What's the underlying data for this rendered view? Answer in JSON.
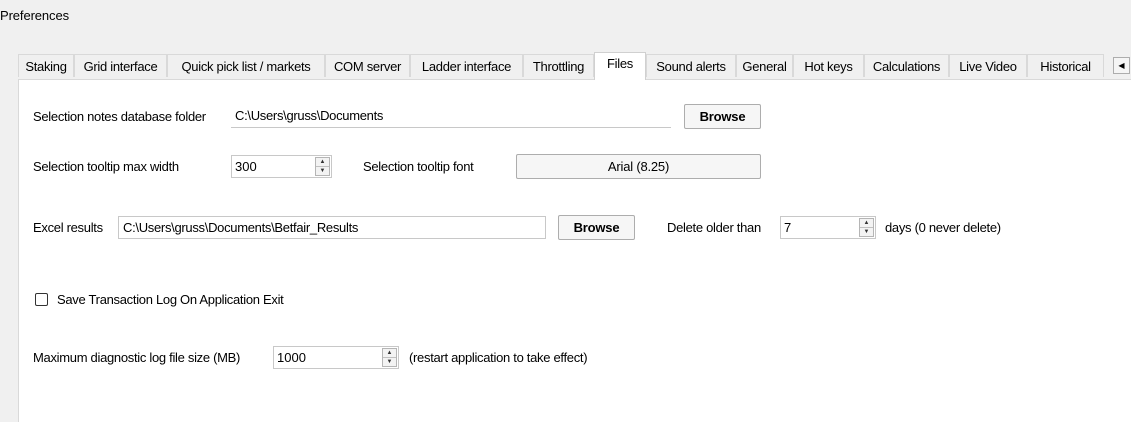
{
  "window": {
    "title": "Preferences"
  },
  "tabs": [
    {
      "label": "Staking"
    },
    {
      "label": "Grid interface"
    },
    {
      "label": "Quick pick list / markets"
    },
    {
      "label": "COM server"
    },
    {
      "label": "Ladder interface"
    },
    {
      "label": "Throttling"
    },
    {
      "label": "Files",
      "active": true
    },
    {
      "label": "Sound alerts"
    },
    {
      "label": "General"
    },
    {
      "label": "Hot keys"
    },
    {
      "label": "Calculations"
    },
    {
      "label": "Live Video"
    },
    {
      "label": "Historical"
    }
  ],
  "tab_scroll": {
    "left_icon": "triangle-left-icon",
    "right_icon": "triangle-right-icon"
  },
  "files": {
    "notes_folder_label": "Selection notes database folder",
    "notes_folder_value": "C:\\Users\\gruss\\Documents",
    "notes_browse_label": "Browse",
    "tooltip_width_label": "Selection tooltip max width",
    "tooltip_width_value": "300",
    "tooltip_font_label": "Selection tooltip font",
    "tooltip_font_value": "Arial (8.25)",
    "excel_label": "Excel results",
    "excel_value": "C:\\Users\\gruss\\Documents\\Betfair_Results",
    "excel_browse_label": "Browse",
    "delete_older_label": "Delete older than",
    "delete_older_value": "7",
    "delete_older_suffix": "days (0 never delete)",
    "save_log_label": "Save Transaction Log On Application Exit",
    "save_log_checked": false,
    "max_log_label": "Maximum diagnostic log file size (MB)",
    "max_log_value": "1000",
    "max_log_note": "(restart application to take effect)"
  }
}
